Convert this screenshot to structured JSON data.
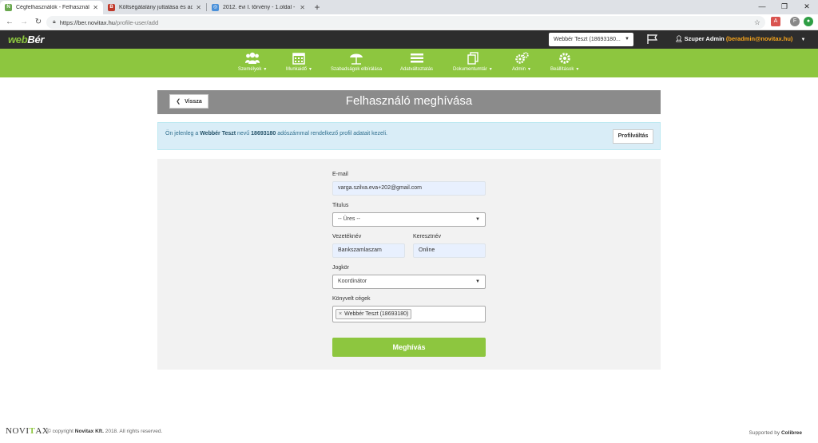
{
  "browser": {
    "tabs": [
      {
        "title": "Cégfelhasználók - Felhasználó m",
        "favicon_color": "#6aa84f",
        "favicon_glyph": "N",
        "active": true
      },
      {
        "title": "Költségátalány juttatása és adózá",
        "favicon_color": "#c0392b",
        "favicon_glyph": "B",
        "active": false
      },
      {
        "title": "2012. évi I. törvény - 1.oldal - Ha",
        "favicon_color": "#4a90d9",
        "favicon_glyph": "◎",
        "active": false
      }
    ],
    "url_host": "https://ber.novitax.hu",
    "url_path": "/profile-user/add"
  },
  "header": {
    "logo_prefix": "web",
    "logo_suffix": "Bér",
    "company_select": "Webbér Teszt (18693180...",
    "user_name": "Szuper Admin",
    "user_email": "(beradmin@novitax.hu)"
  },
  "nav": {
    "items": [
      {
        "label": "Személyek",
        "icon": "people-icon",
        "has_dropdown": true
      },
      {
        "label": "Munkaidő",
        "icon": "calendar-icon",
        "has_dropdown": true
      },
      {
        "label": "Szabadságok elbírálása",
        "icon": "beach-umbrella-icon",
        "has_dropdown": false
      },
      {
        "label": "Adatváltoztatás",
        "icon": "list-icon",
        "has_dropdown": false
      },
      {
        "label": "Dokumentumtár",
        "icon": "documents-icon",
        "has_dropdown": true
      },
      {
        "label": "Admin",
        "icon": "gears-icon",
        "has_dropdown": true
      },
      {
        "label": "Beállítások",
        "icon": "gear-icon",
        "has_dropdown": true
      }
    ]
  },
  "page": {
    "back_label": "Vissza",
    "title": "Felhasználó meghívása"
  },
  "info": {
    "text_1": "Ön jelenleg a ",
    "company": "Webbér Teszt",
    "text_2": " nevű ",
    "tax_number": "18693180",
    "text_3": " adószámmal rendelkező profil adatait kezeli.",
    "switch_label": "Profilváltás"
  },
  "form": {
    "email_label": "E-mail",
    "email_value": "varga.szilva.eva+202@gmail.com",
    "title_label": "Titulus",
    "title_value": "-- Üres --",
    "lastname_label": "Vezetéknév",
    "lastname_value": "Bankszamlaszam",
    "firstname_label": "Keresztnév",
    "firstname_value": "Online",
    "role_label": "Jogkör",
    "role_value": "Koordinátor",
    "companies_label": "Könyvelt cégek",
    "companies_tags": [
      "Webbér Teszt (18693180)"
    ],
    "submit_label": "Meghívás"
  },
  "footer": {
    "logo_1": "NOVI",
    "logo_x": "T",
    "logo_2": "AX",
    "copyright_1": "© copyright ",
    "copyright_company": "Novitax Kft.",
    "copyright_2": " 2018. All rights reserved.",
    "supported_1": "Supported by ",
    "supported_company": "Colibree"
  },
  "colors": {
    "brand_green": "#8dc63f",
    "header_dark": "#2d2d2d",
    "title_gray": "#8b8b8b",
    "info_bg": "#d9edf7",
    "email_orange": "#f7a51c"
  }
}
